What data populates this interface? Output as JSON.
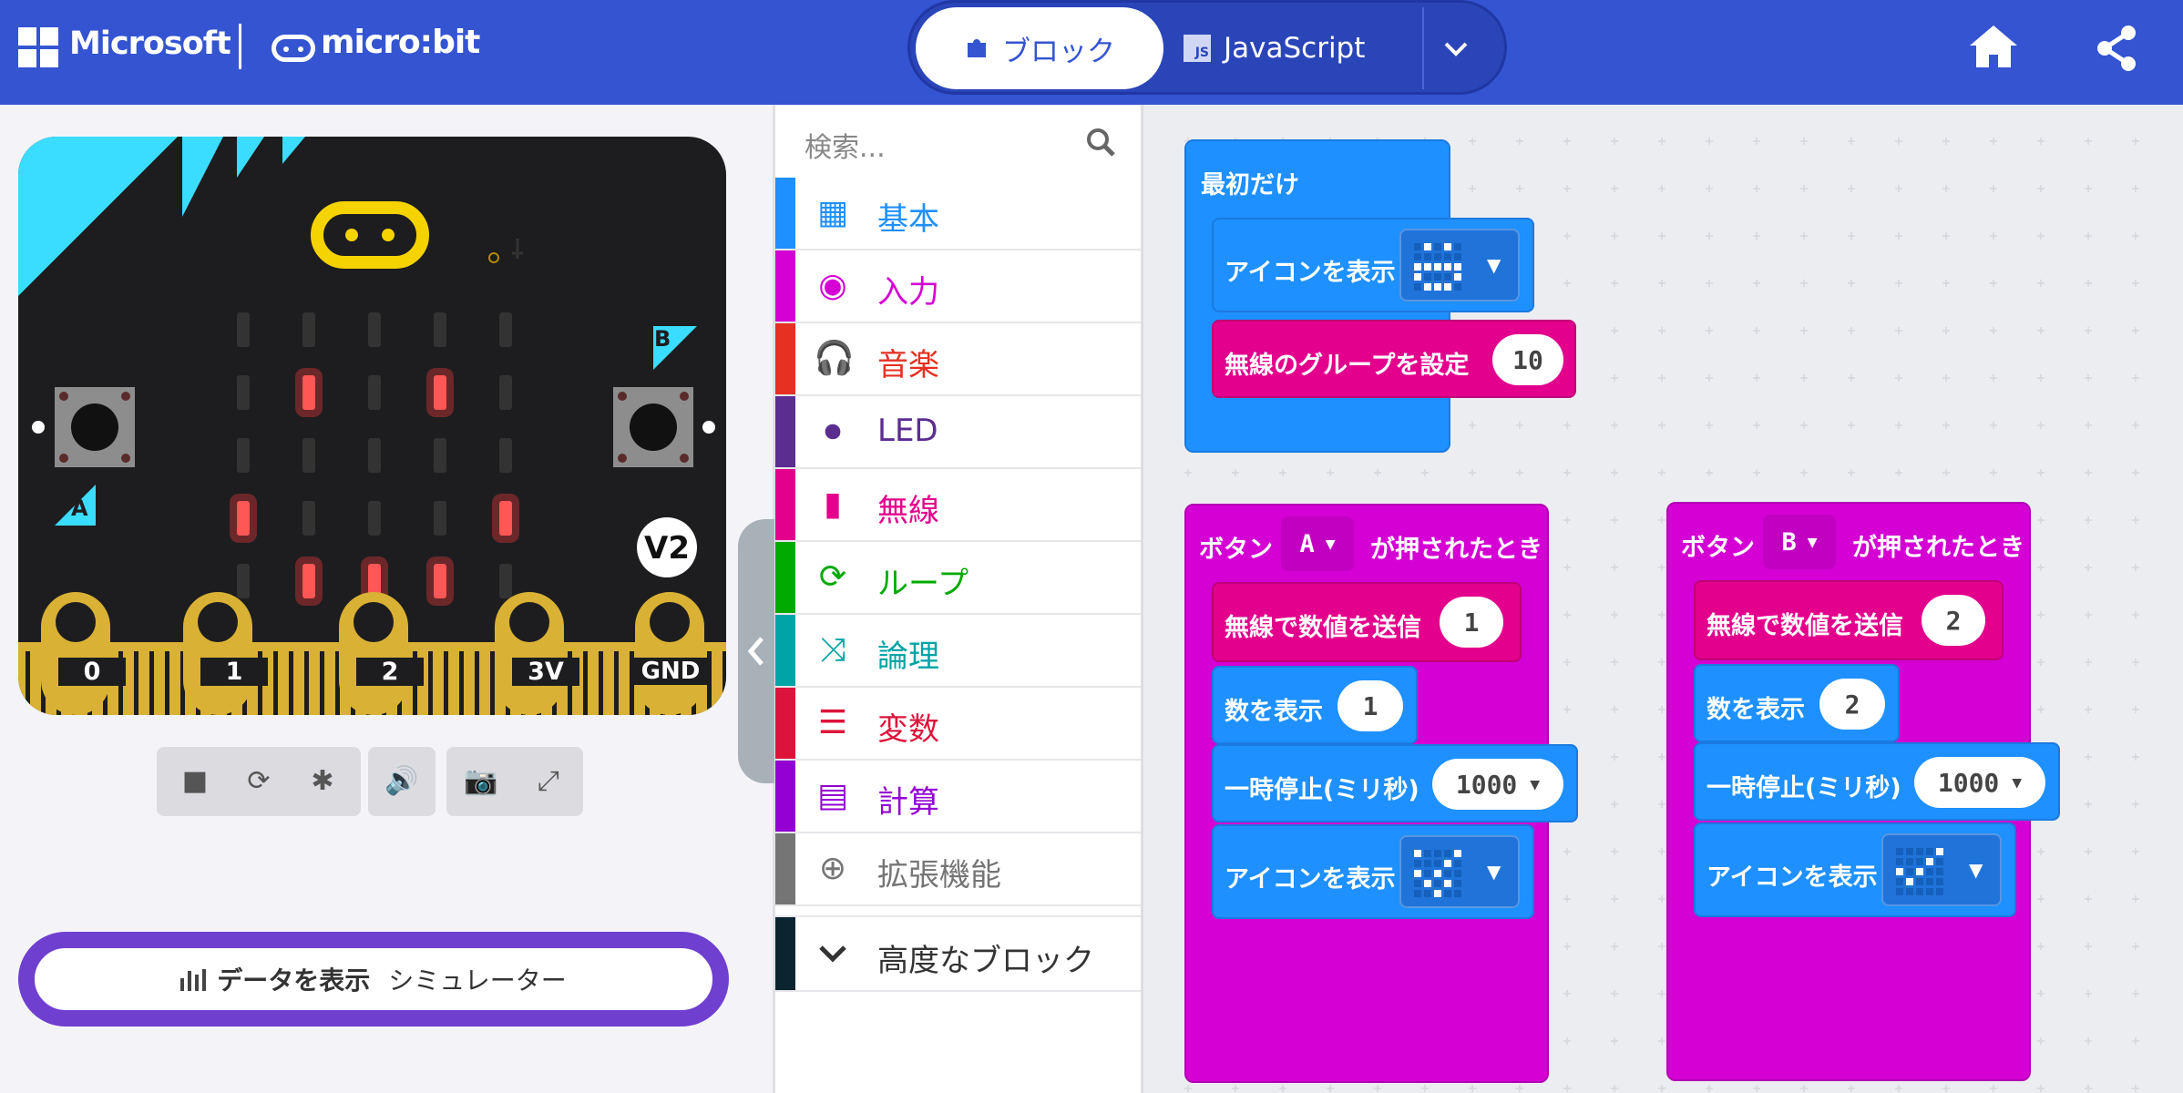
{
  "header": {
    "brand": "Microsoft",
    "product": "micro:bit",
    "tabs": {
      "blocks": "ブロック",
      "javascript": "JavaScript"
    },
    "js_badge": "JS"
  },
  "simulator": {
    "board_labels": {
      "button_a": "A",
      "button_b": "B",
      "version": "V2"
    },
    "pins": [
      "0",
      "1",
      "2",
      "3V",
      "GND"
    ],
    "led_matrix": [
      [
        0,
        0,
        0,
        0,
        0
      ],
      [
        0,
        1,
        0,
        1,
        0
      ],
      [
        0,
        0,
        0,
        0,
        0
      ],
      [
        1,
        0,
        0,
        0,
        1
      ],
      [
        0,
        1,
        1,
        1,
        0
      ]
    ],
    "data_button": {
      "part1": "データを表示",
      "part2": "シミュレーター"
    }
  },
  "toolbox": {
    "search_placeholder": "検索...",
    "categories": [
      {
        "label": "基本",
        "color": "#1e90ff",
        "icon": "grid-icon"
      },
      {
        "label": "入力",
        "color": "#d400d4",
        "icon": "circle-icon"
      },
      {
        "label": "音楽",
        "color": "#e63022",
        "icon": "headphones-icon"
      },
      {
        "label": "LED",
        "color": "#5c2d91",
        "icon": "toggle-icon"
      },
      {
        "label": "無線",
        "color": "#e3008c",
        "icon": "signal-icon"
      },
      {
        "label": "ループ",
        "color": "#00aa00",
        "icon": "refresh-icon"
      },
      {
        "label": "論理",
        "color": "#00a4a6",
        "icon": "shuffle-icon"
      },
      {
        "label": "変数",
        "color": "#dc143c",
        "icon": "lines-icon"
      },
      {
        "label": "計算",
        "color": "#9400d3",
        "icon": "calculator-icon"
      },
      {
        "label": "拡張機能",
        "color": "#757575",
        "icon": "plus-icon"
      }
    ],
    "advanced": "高度なブロック"
  },
  "workspace": {
    "on_start": {
      "hat": "最初だけ",
      "show_icon": "アイコンを表示",
      "set_group": "無線のグループを設定",
      "group_value": "10"
    },
    "button_a": {
      "prefix": "ボタン",
      "button": "A",
      "suffix": "が押されたとき",
      "send": "無線で数値を送信",
      "send_value": "1",
      "show_number": "数を表示",
      "number_value": "1",
      "pause": "一時停止(ミリ秒)",
      "pause_value": "1000",
      "show_icon": "アイコンを表示"
    },
    "button_b": {
      "prefix": "ボタン",
      "button": "B",
      "suffix": "が押されたとき",
      "send": "無線で数値を送信",
      "send_value": "2",
      "show_number": "数を表示",
      "number_value": "2",
      "pause": "一時停止(ミリ秒)",
      "pause_value": "1000",
      "show_icon": "アイコンを表示"
    },
    "colors": {
      "basic": "#1e90ff",
      "radio": "#e3008c",
      "input": "#d400d4"
    }
  }
}
